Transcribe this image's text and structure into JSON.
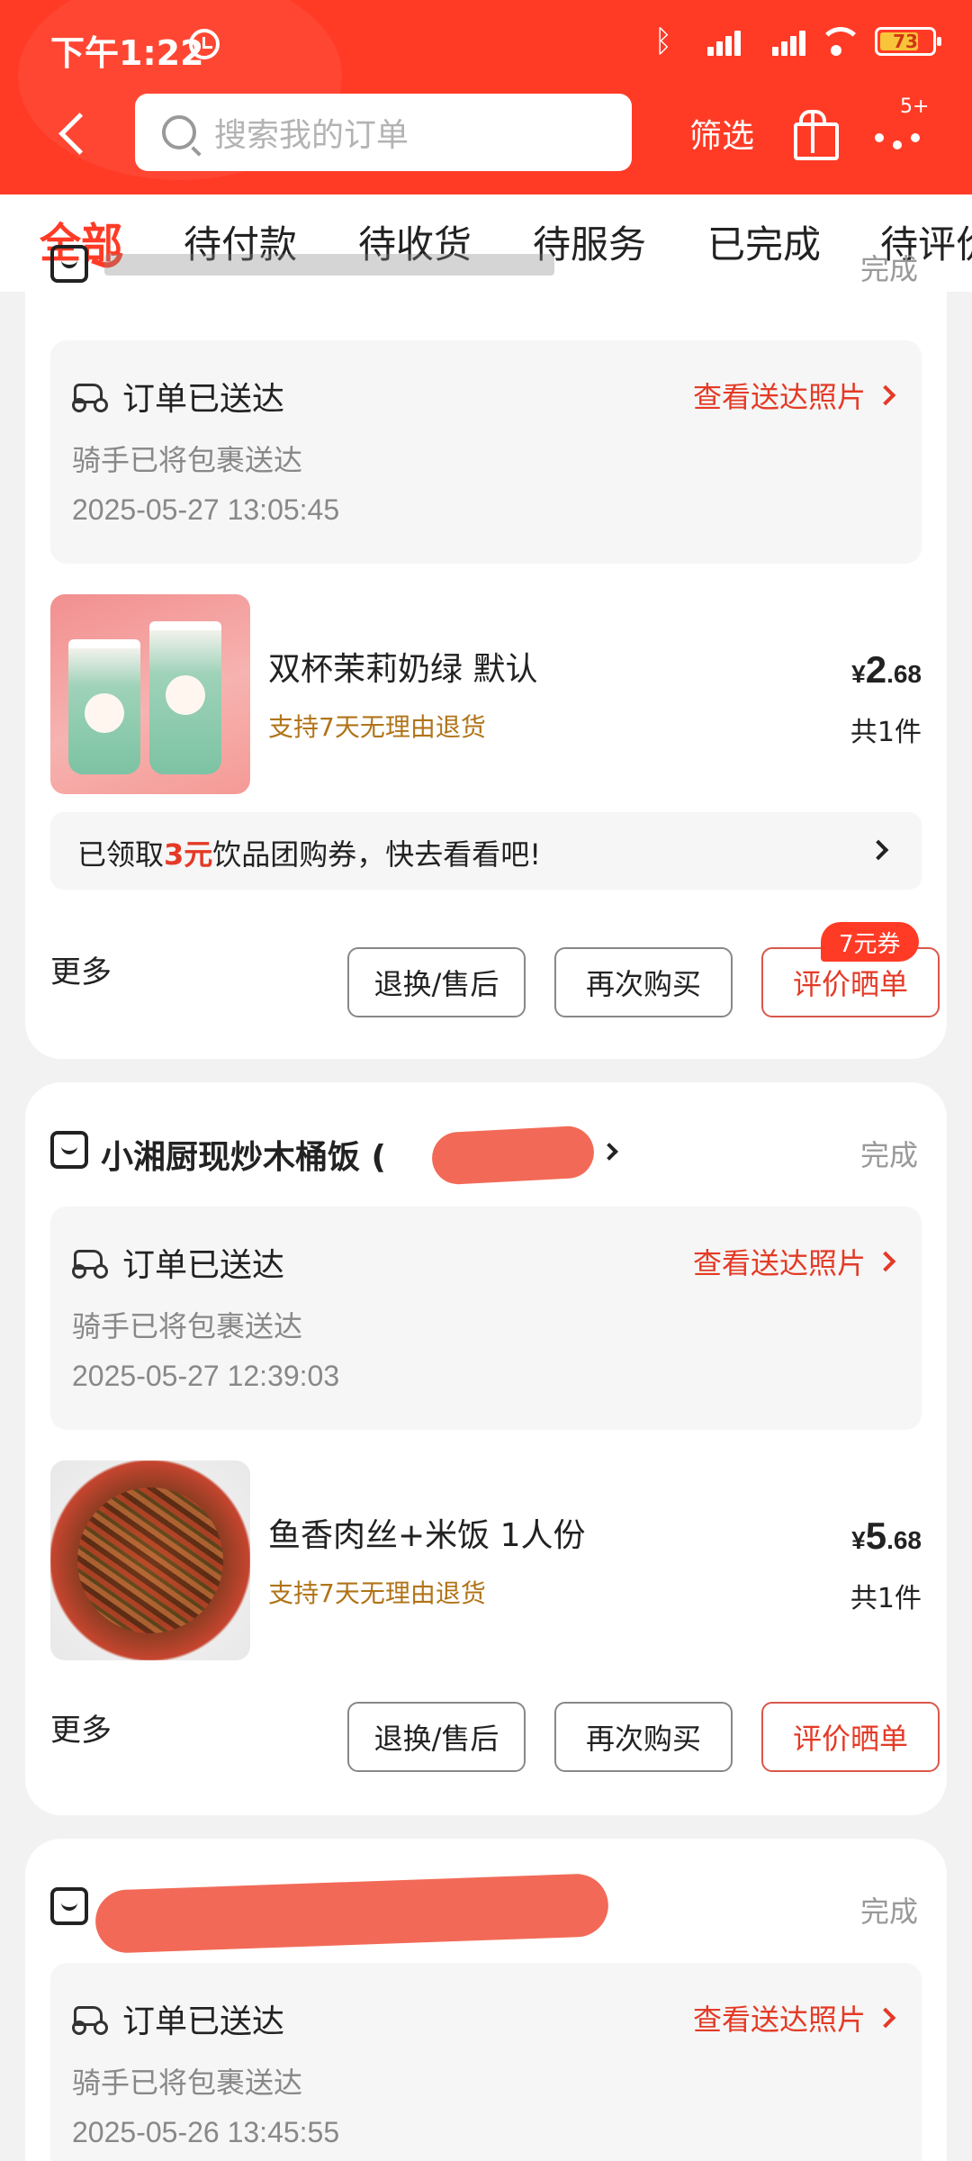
{
  "status_bar": {
    "time": "下午1:22",
    "battery": "73"
  },
  "header": {
    "search_placeholder": "搜索我的订单",
    "filter_label": "筛选",
    "more_badge": "5+"
  },
  "tabs": [
    "全部",
    "待付款",
    "待收货",
    "待服务",
    "已完成",
    "待评价"
  ],
  "orders": [
    {
      "store_name": "",
      "status": "完成",
      "delivery": {
        "title": "订单已送达",
        "photo_link": "查看送达照片",
        "desc": "骑手已将包裹送达",
        "time": "2025-05-27 13:05:45"
      },
      "product": {
        "name": "双杯茉莉奶绿 默认",
        "return_policy": "支持7天无理由退货",
        "price_symbol": "¥",
        "price_int": "2",
        "price_dec": ".68",
        "qty": "共1件"
      },
      "coupon": {
        "prefix": "已领取",
        "amount": "3元",
        "suffix": "饮品团购券，快去看看吧!"
      },
      "actions": {
        "more": "更多",
        "after_sale": "退换/售后",
        "rebuy": "再次购买",
        "review": "评价晒单",
        "review_badge": "7元券"
      }
    },
    {
      "store_name": "小湘厨现炒木桶饭 (",
      "status": "完成",
      "delivery": {
        "title": "订单已送达",
        "photo_link": "查看送达照片",
        "desc": "骑手已将包裹送达",
        "time": "2025-05-27 12:39:03"
      },
      "product": {
        "name": "鱼香肉丝+米饭 1人份",
        "return_policy": "支持7天无理由退货",
        "price_symbol": "¥",
        "price_int": "5",
        "price_dec": ".68",
        "qty": "共1件"
      },
      "actions": {
        "more": "更多",
        "after_sale": "退换/售后",
        "rebuy": "再次购买",
        "review": "评价晒单"
      }
    },
    {
      "store_name": "",
      "status": "完成",
      "delivery": {
        "title": "订单已送达",
        "photo_link": "查看送达照片",
        "desc": "骑手已将包裹送达",
        "time": "2025-05-26 13:45:55"
      }
    }
  ],
  "colors": {
    "brand_red": "#ff3b26",
    "link_red": "#e43a26",
    "return_gold": "#b07418"
  }
}
